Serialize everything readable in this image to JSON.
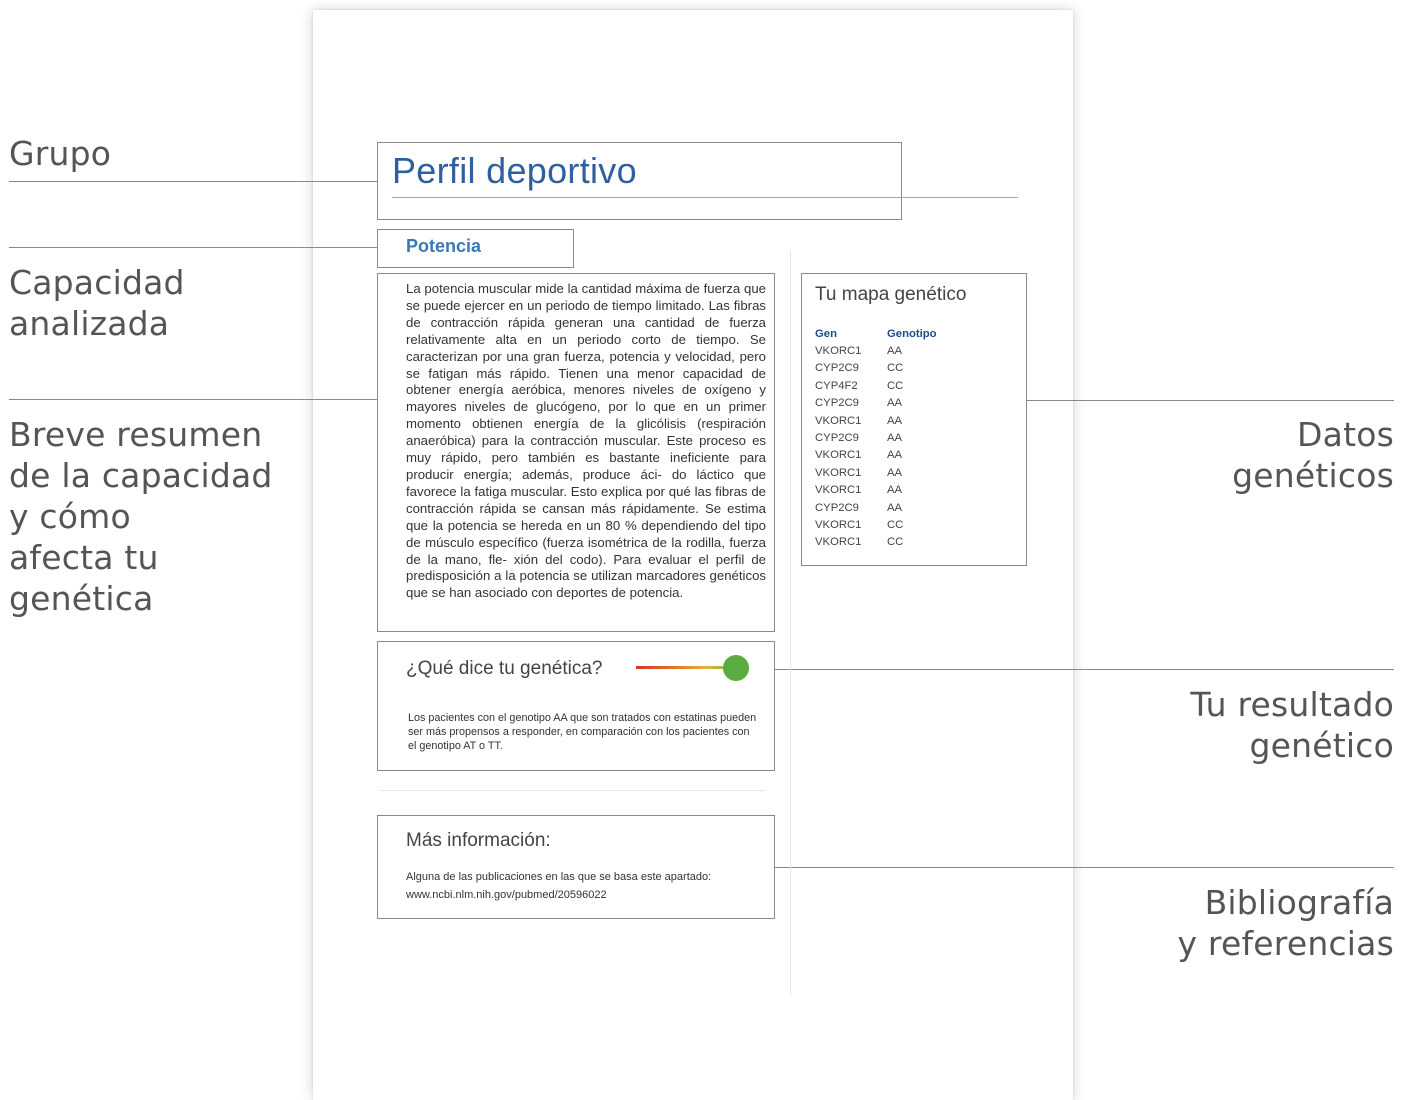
{
  "labels": {
    "grupo": "Grupo",
    "capacidad": [
      "Capacidad",
      "analizada"
    ],
    "resumen": [
      "Breve resumen",
      "de la capacidad",
      "y cómo",
      "afecta tu",
      "genética"
    ],
    "datos": [
      "Datos",
      "genéticos"
    ],
    "resultado": [
      "Tu resultado",
      "genético"
    ],
    "bibliografia": [
      "Bibliografía",
      "y referencias"
    ]
  },
  "document": {
    "title": "Perfil deportivo",
    "subtitle": "Potencia",
    "summary": "La potencia muscular mide la cantidad máxima de fuerza que se puede ejercer en un periodo de tiempo limitado. Las fibras de contracción rápida generan una cantidad de fuerza relativamente alta en un periodo corto de tiempo. Se caracterizan por una gran fuerza, potencia y velocidad, pero se fatigan más rápido. Tienen una menor capacidad de obtener energía aeróbica, menores niveles de oxígeno y mayores niveles de glucógeno, por lo que en un primer momento obtienen energía de la glicólisis (respiración anaeróbica) para la contracción muscular. Este proceso es muy rápido, pero también es bastante ineficiente para producir energía; además, produce áci- do láctico que favorece la fatiga muscular. Esto explica por qué las fibras de contracción rápida se cansan más rápidamente. Se estima que la potencia se hereda en un 80 % dependiendo del tipo de músculo específico (fuerza isométrica de la rodilla, fuerza de la mano, fle- xión del codo). Para evaluar el perfil de predisposición a la potencia se utilizan marcadores genéticos que se han asociado con deportes de potencia.",
    "genetic_map": {
      "title": "Tu mapa genético",
      "headers": [
        "Gen",
        "Genotipo"
      ],
      "rows": [
        [
          "VKORC1",
          "AA"
        ],
        [
          "CYP2C9",
          "CC"
        ],
        [
          "CYP4F2",
          "CC"
        ],
        [
          "CYP2C9",
          "AA"
        ],
        [
          "VKORC1",
          "AA"
        ],
        [
          "CYP2C9",
          "AA"
        ],
        [
          "VKORC1",
          "AA"
        ],
        [
          "VKORC1",
          "AA"
        ],
        [
          "VKORC1",
          "AA"
        ],
        [
          "CYP2C9",
          "AA"
        ],
        [
          "VKORC1",
          "CC"
        ],
        [
          "VKORC1",
          "CC"
        ]
      ]
    },
    "result": {
      "title": "¿Qué dice tu genética?",
      "gauge_level": 1.0,
      "gauge_colors": [
        "#d9342b",
        "#e58a2a",
        "#e2b33a",
        "#7bbf3a"
      ],
      "knob_color": "#5aac3e",
      "text": "Los pacientes con el genotipo AA que son tratados con estatinas pueden ser más propensos a responder, en comparación con los pacientes con el genotipo AT o TT."
    },
    "more_info": {
      "title": "Más información:",
      "text": "Alguna de las publicaciones en las que se basa este apartado:",
      "link": "www.ncbi.nlm.nih.gov/pubmed/20596022"
    }
  },
  "colors": {
    "title": "#2f5f9e",
    "subtitle": "#3a78b8",
    "table_header": "#1e4d8c",
    "connector": "#8a8a8a"
  }
}
